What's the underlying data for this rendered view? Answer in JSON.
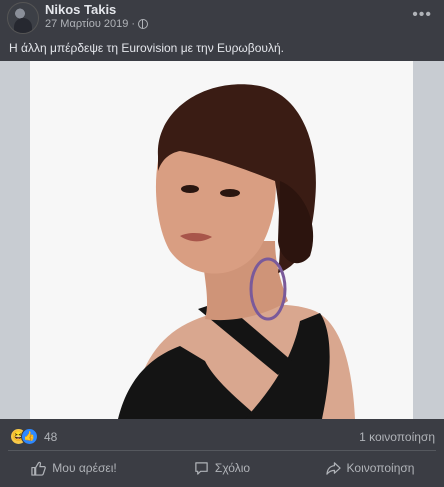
{
  "post": {
    "author": "Nikos Takis",
    "date": "27 Μαρτίου 2019",
    "date_separator": "·",
    "privacy_icon": "globe-icon",
    "more_label": "•••",
    "caption": "Η άλλη μπέρδεψε τη Eurovision με την Ευρωβουλή."
  },
  "stats": {
    "reaction_icons": [
      "haha-icon",
      "like-icon"
    ],
    "reaction_count": "48",
    "shares": "1 κοινοποίηση"
  },
  "actions": {
    "like": "Μου αρέσει!",
    "comment": "Σχόλιο",
    "share": "Κοινοποίηση"
  },
  "colors": {
    "background": "#3b3d44",
    "text_primary": "#e4e6eb",
    "text_secondary": "#b0b3b8",
    "like_blue": "#2d88ff",
    "haha_yellow": "#f7c94a"
  }
}
